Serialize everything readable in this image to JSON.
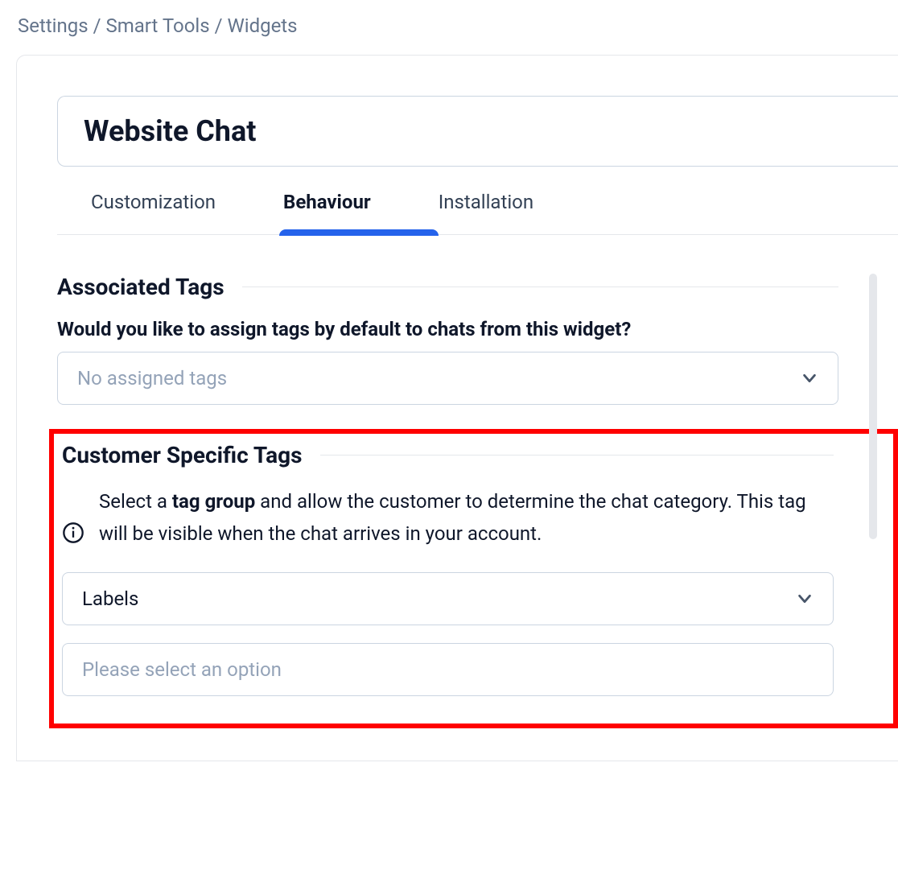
{
  "breadcrumb": {
    "items": [
      "Settings",
      "Smart Tools",
      "Widgets"
    ],
    "separator": " / "
  },
  "page_title": "Website Chat",
  "tabs": [
    {
      "label": "Customization",
      "active": false
    },
    {
      "label": "Behaviour",
      "active": true
    },
    {
      "label": "Installation",
      "active": false
    }
  ],
  "sections": {
    "associated_tags": {
      "title": "Associated Tags",
      "question": "Would you like to assign tags by default to chats from this widget?",
      "select_placeholder": "No assigned tags"
    },
    "customer_specific_tags": {
      "title": "Customer Specific Tags",
      "info_pre": "Select a ",
      "info_bold": "tag group",
      "info_post": " and allow the customer to determine the chat category. This tag will be visible when the chat arrives in your account.",
      "select1_value": "Labels",
      "select2_placeholder": "Please select an option"
    }
  }
}
